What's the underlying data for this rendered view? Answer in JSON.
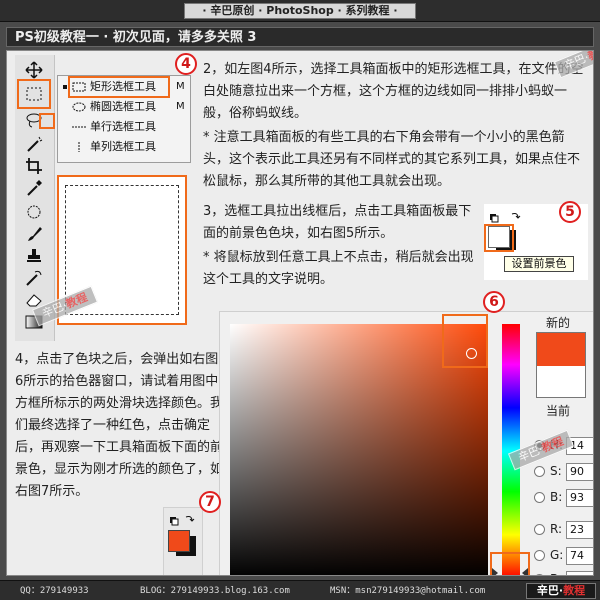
{
  "header": {
    "title": "· 辛巴原创 · PhotoShop · 系列教程 ·"
  },
  "section": {
    "title": "PS初级教程一 · 初次见面，请多多关照 3"
  },
  "toolbox_flyout": {
    "items": [
      {
        "label": "矩形选框工具",
        "key": "M"
      },
      {
        "label": "椭圆选框工具",
        "key": "M"
      },
      {
        "label": "单行选框工具",
        "key": ""
      },
      {
        "label": "单列选框工具",
        "key": ""
      }
    ]
  },
  "figures": {
    "fig4": "4",
    "fig5": "5",
    "fig6": "6",
    "fig7": "7"
  },
  "body": {
    "p1": "2，如左图4所示，选择工具箱面板中的矩形选框工具，在文件的空白处随意拉出来一个方框，这个方框的边线如同一排排小蚂蚁一般，俗称蚂蚁线。",
    "p2": "* 注意工具箱面板的有些工具的右下角会带有一个小小的黑色箭头，这个表示此工具还另有不同样式的其它系列工具，如果点住不松鼠标，那么其所带的其他工具就会出现。",
    "p3": "3，选框工具拉出线框后，点击工具箱面板最下面的前景色色块，如右图5所示。",
    "p4": "* 将鼠标放到任意工具上不点击，稍后就会出现这个工具的文字说明。",
    "p5": "4，点击了色块之后，会弹出如右图6所示的拾色器窗口，请试着用图中方框所标示的两处滑块选择颜色。我们最终选择了一种红色，点击确定后，再观察一下工具箱面板下面的前景色，显示为刚才所选的颜色了，如右图7所示。"
  },
  "tooltip": {
    "text": "设置前景色"
  },
  "color_picker": {
    "new_label": "新的",
    "current_label": "当前",
    "fields": [
      {
        "label": "H:",
        "value": "14",
        "selected": true
      },
      {
        "label": "S:",
        "value": "90",
        "selected": false
      },
      {
        "label": "B:",
        "value": "93",
        "selected": false
      },
      {
        "label": "R:",
        "value": "23",
        "selected": false
      },
      {
        "label": "G:",
        "value": "74",
        "selected": false
      },
      {
        "label": "B:",
        "value": "",
        "selected": false
      }
    ],
    "new_color": "#f04a1a",
    "current_color": "#ffffff"
  },
  "watermark": {
    "text_a": "辛巴",
    "text_b": "教程"
  },
  "footer": {
    "qq": "QQ：279149933",
    "blog": "BLOG：279149933.blog.163.com",
    "msn": "MSN：msn279149933@hotmail.com",
    "brand_a": "辛巴",
    "brand_b": "教程"
  }
}
